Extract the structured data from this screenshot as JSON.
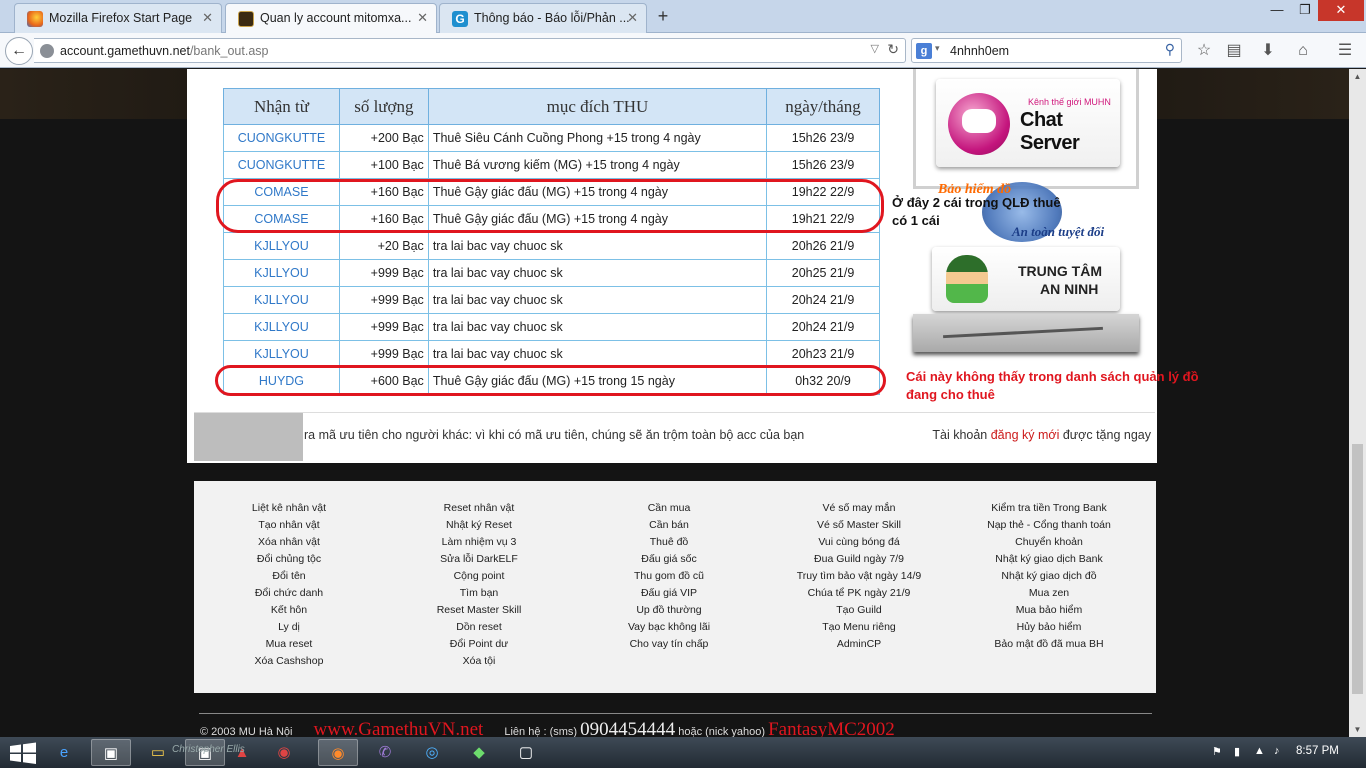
{
  "browser": {
    "tabs": [
      {
        "title": "Mozilla Firefox Start Page",
        "active": false
      },
      {
        "title": "Quan ly account mitomxa...",
        "active": true
      },
      {
        "title": "Thông báo - Báo lỗi/Phản ...",
        "active": false
      }
    ],
    "new_tab": "+",
    "url_domain": "account.gamethuvn.net",
    "url_path": "/bank_out.asp",
    "search_value": "4nhnh0em"
  },
  "bank_table": {
    "headers": [
      "Nhận từ",
      "số lượng",
      "mục đích THU",
      "ngày/tháng"
    ],
    "rows": [
      [
        "CUONGKUTTE",
        "+200  Bạc",
        "Thuê Siêu Cánh Cuồng Phong +15 trong 4 ngày",
        "15h26 23/9"
      ],
      [
        "CUONGKUTTE",
        "+100  Bạc",
        "Thuê Bá vương kiếm (MG) +15 trong 4 ngày",
        "15h26 23/9"
      ],
      [
        "COMASE",
        "+160  Bạc",
        "Thuê Gậy giác đấu (MG) +15 trong 4 ngày",
        "19h22 22/9"
      ],
      [
        "COMASE",
        "+160  Bạc",
        "Thuê Gậy giác đấu (MG) +15 trong 4 ngày",
        "19h21 22/9"
      ],
      [
        "KJLLYOU",
        "+20  Bạc",
        "tra lai bac vay chuoc sk",
        "20h26 21/9"
      ],
      [
        "KJLLYOU",
        "+999  Bạc",
        "tra lai bac vay chuoc sk",
        "20h25 21/9"
      ],
      [
        "KJLLYOU",
        "+999  Bạc",
        "tra lai bac vay chuoc sk",
        "20h24 21/9"
      ],
      [
        "KJLLYOU",
        "+999  Bạc",
        "tra lai bac vay chuoc sk",
        "20h24 21/9"
      ],
      [
        "KJLLYOU",
        "+999  Bạc",
        "tra lai bac vay chuoc sk",
        "20h23 21/9"
      ],
      [
        "HUYDG",
        "+600  Bạc",
        "Thuê Gậy giác đấu (MG) +15 trong 15 ngày",
        "0h32 20/9"
      ]
    ]
  },
  "annotations": {
    "note1": "Ở đây 2 cái trong QLĐ thuê có 1 cái",
    "note2": "Cái này không thấy trong danh sách quản lý đồ đang cho thuê"
  },
  "sidebar": {
    "chat_small": "Kênh thế giới MUHN",
    "chat_big": "Chat Server",
    "insurance_top": "Bảo hiểm đồ",
    "insurance_bottom": "An toàn tuyệt đối",
    "security_l1": "TRUNG TÂM",
    "security_l2": "AN NINH"
  },
  "marquee": {
    "text": "ra mã ưu tiên cho người khác: vì khi có mã ưu tiên, chúng sẽ ăn trộm toàn bộ acc của bạn",
    "right_prefix": "Tài khoản ",
    "right_link": "đăng ký mới",
    "right_suffix": " được tặng ngay"
  },
  "footer_menu": [
    [
      "Liệt kê nhân vật",
      "Tạo nhân vật",
      "Xóa nhân vật",
      "Đổi chủng tộc",
      "Đổi tên",
      "Đổi chức danh",
      "Kết hôn",
      "Ly dị",
      "Mua reset",
      "Xóa Cashshop"
    ],
    [
      "Reset nhân vật",
      "Nhật ký Reset",
      "Làm nhiệm vụ 3",
      "Sửa lỗi DarkELF",
      "Cộng point",
      "Tìm bạn",
      "Reset Master Skill",
      "Dồn reset",
      "Đổi Point dư",
      "Xóa tội"
    ],
    [
      "Cần mua",
      "Cần bán",
      "Thuê đồ",
      "Đấu giá sốc",
      "Thu gom đồ cũ",
      "Đấu giá VIP",
      "Up đồ thường",
      "Vay bạc không lãi",
      "Cho vay tín chấp"
    ],
    [
      "Vé số may mắn",
      "Vé số Master Skill",
      "Vui cùng bóng đá",
      "Đua Guild ngày 7/9",
      "Truy tìm bảo vật ngày 14/9",
      "Chúa tể PK ngày 21/9",
      "Tạo Guild",
      "Tạo Menu riêng",
      "AdminCP"
    ],
    [
      "Kiểm tra tiền Trong Bank",
      "Nạp thẻ - Cổng thanh toán",
      "Chuyển khoản",
      "Nhật ký giao dịch Bank",
      "Nhật ký giao dịch đồ",
      "Mua zen",
      "Mua bảo hiểm",
      "Hủy bảo hiểm",
      "Bảo mật đồ đã mua BH"
    ]
  ],
  "footer": {
    "copyright": "© 2003 MU Hà Nội",
    "site": "www.GamethuVN.net",
    "contact_label": "Liên hệ : (sms)",
    "phone": "0904454444",
    "nick_label": "hoặc (nick yahoo)",
    "nick": "FantasyMC2002"
  },
  "taskbar": {
    "clock": "8:57 PM",
    "overlay_text": "Christopher Ellis"
  },
  "colors": {
    "table_header_bg": "#d3e5f6",
    "table_border": "#7cc0e6",
    "name_link": "#2f78c8",
    "annotation_red": "#e0161f"
  }
}
